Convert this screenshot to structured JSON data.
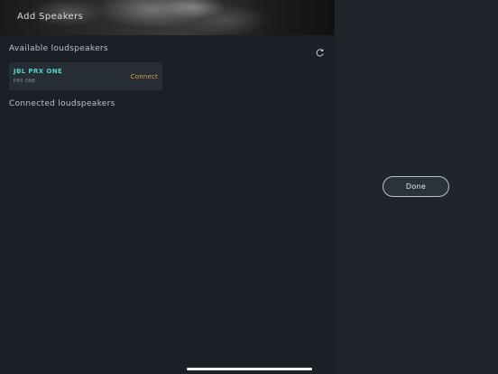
{
  "header": {
    "title": "Add Speakers"
  },
  "available": {
    "section_label": "Available loudspeakers",
    "refresh_icon": "refresh-icon",
    "devices": [
      {
        "name": "JBL PRX ONE",
        "model": "PRX ONE",
        "action_label": "Connect"
      }
    ]
  },
  "connected": {
    "section_label": "Connected loudspeakers"
  },
  "done_button": {
    "label": "Done"
  },
  "colors": {
    "accent_teal": "#57d1c6",
    "connect_orange": "#e5a24a",
    "background": "#1b2026"
  }
}
